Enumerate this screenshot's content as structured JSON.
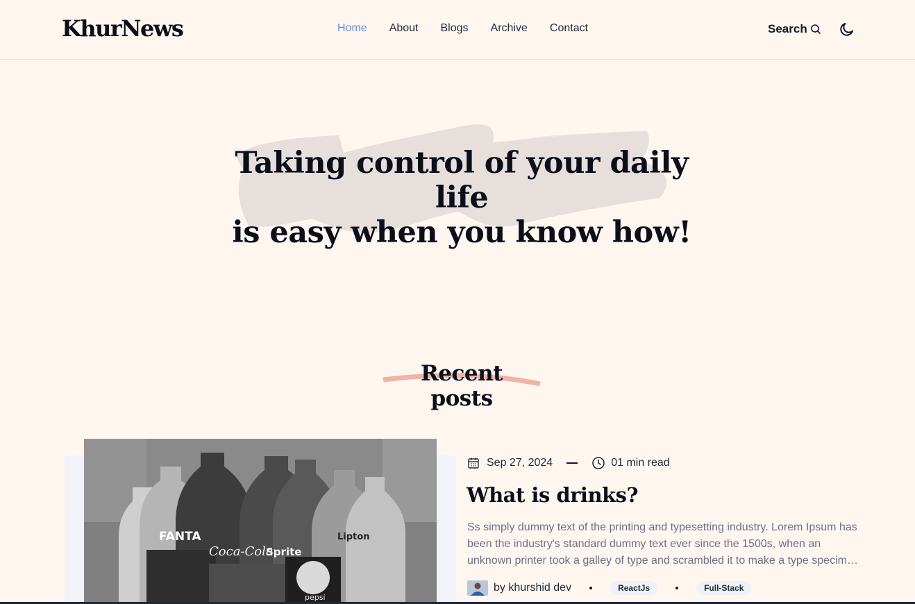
{
  "header": {
    "logo": "KhurNews",
    "nav": [
      "Home",
      "About",
      "Blogs",
      "Archive",
      "Contact"
    ],
    "active_nav": "Home",
    "search_label": "Search",
    "search_icon": "search-icon",
    "theme_icon": "moon-icon"
  },
  "hero": {
    "line1": "Taking control of your daily life",
    "line2": "is easy when you know how!"
  },
  "recent": {
    "title": "Recent posts"
  },
  "posts": [
    {
      "date": "Sep 27, 2024",
      "read_time": "01 min read",
      "title": "What is drinks?",
      "excerpt": "Ss simply dummy text of the printing and typesetting industry. Lorem Ipsum has been the industry's standard dummy text ever since the 1500s, when an unknown printer took a galley of type and scrambled it to make a type specimen book.",
      "author": "by khurshid dev",
      "tags": [
        "ReactJs",
        "Full-Stack"
      ],
      "image_text": [
        "FANTA",
        "Coca-Cola",
        "Sprite",
        "Lipton",
        "pepsi"
      ]
    }
  ],
  "colors": {
    "background": "#fff6f0",
    "active_nav": "#5b8ee6",
    "brush": "#e6dfdb",
    "underline": "#f0b3a6",
    "card_bg": "#f1f3f8",
    "tag_bg": "#eef1f6"
  }
}
